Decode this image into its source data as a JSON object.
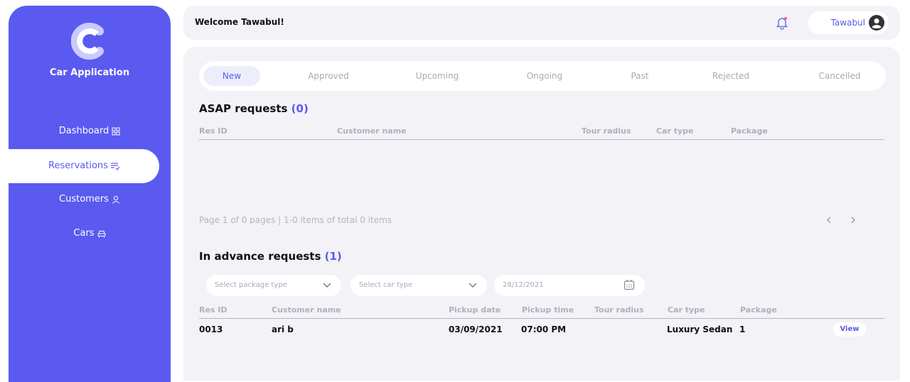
{
  "app": {
    "name": "Car Application"
  },
  "sidebar": {
    "items": [
      {
        "label": "Dashboard",
        "icon": "grid-icon"
      },
      {
        "label": "Reservations",
        "icon": "list-check-icon"
      },
      {
        "label": "Customers",
        "icon": "user-icon"
      },
      {
        "label": "Cars",
        "icon": "car-icon"
      }
    ]
  },
  "header": {
    "welcome": "Welcome Tawabul!",
    "user_name": "Tawabul"
  },
  "tabs": [
    "New",
    "Approved",
    "Upcoming",
    "Ongoing",
    "Past",
    "Rejected",
    "Cancelled"
  ],
  "asap": {
    "title": "ASAP requests",
    "count": "(0)",
    "columns": [
      "Res ID",
      "Customer name",
      "Tour radius",
      "Car type",
      "Package"
    ],
    "pagination": "Page 1 of 0 pages | 1-0 items of total 0 items"
  },
  "advance": {
    "title": "In advance requests",
    "count": "(1)",
    "filters": {
      "package_placeholder": "Select package type",
      "car_placeholder": "Select car type",
      "date_value": "28/12/2021"
    },
    "columns": [
      "Res ID",
      "Customer name",
      "Pickup date",
      "Pickup time",
      "Tour radius",
      "Car type",
      "Package"
    ],
    "rows": [
      {
        "res_id": "0013",
        "customer": "ari b",
        "pickup_date": "03/09/2021",
        "pickup_time": "07:00 PM",
        "tour_radius": "",
        "car_type": "Luxury Sedan",
        "package": "1",
        "action": "View"
      }
    ]
  },
  "colors": {
    "accent": "#5a5af0",
    "panel": "#f2f2f7",
    "muted": "#a9a9b8"
  }
}
